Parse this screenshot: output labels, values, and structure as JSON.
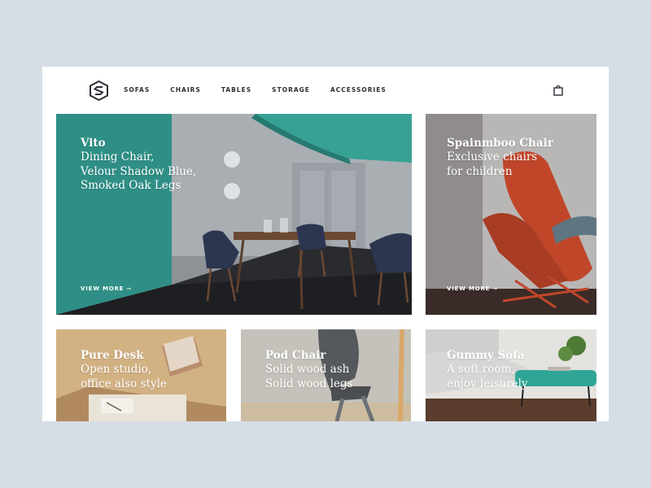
{
  "nav": {
    "items": [
      {
        "label": "SOFAS"
      },
      {
        "label": "CHAIRS"
      },
      {
        "label": "TABLES"
      },
      {
        "label": "STORAGE"
      },
      {
        "label": "ACCESSORIES"
      }
    ]
  },
  "cards": [
    {
      "title": "Vito",
      "lines": [
        "Dining Chair,",
        "Velour Shadow Blue,",
        "Smoked Oak Legs"
      ],
      "cta": "VIEW MORE",
      "arrow": "➞"
    },
    {
      "title": "Spainmboo Chair",
      "lines": [
        "Exclusive chairs",
        "for children"
      ],
      "cta": "VIEW MORE",
      "arrow": "➞"
    },
    {
      "title": "Pure Desk",
      "lines": [
        "Open studio,",
        "office also style"
      ]
    },
    {
      "title": "Pod Chair",
      "lines": [
        "Solid wood ash",
        "Solid wood legs"
      ]
    },
    {
      "title": "Gummy Sofa",
      "lines": [
        "A soft room,",
        "enjoy leisurely"
      ]
    }
  ],
  "colors": {
    "background": "#d6dde5",
    "teal": "#2f8f86",
    "rust": "#c0462a",
    "navy": "#2c3650"
  },
  "icons": {
    "logo": "hexagon-s-logo",
    "cart": "shopping-bag-icon"
  }
}
